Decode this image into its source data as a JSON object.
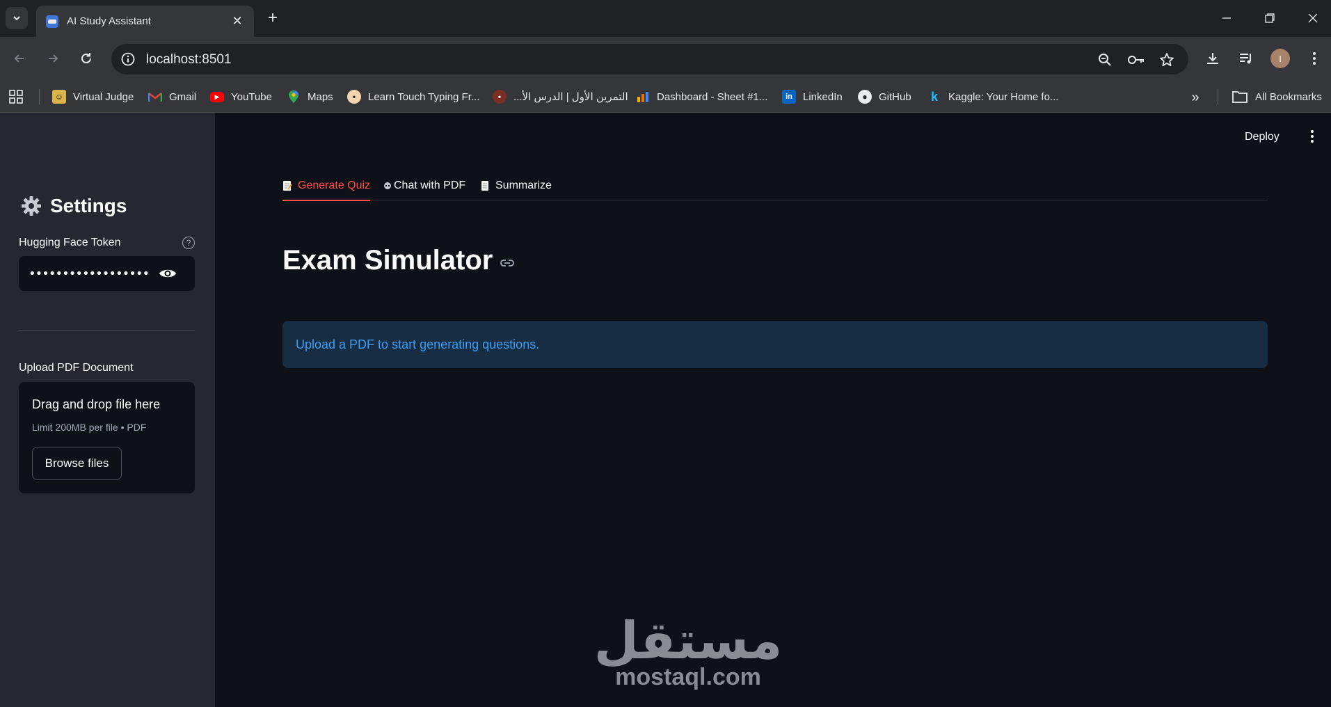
{
  "browser": {
    "tab_title": "AI Study Assistant",
    "url": "localhost:8501",
    "avatar_initial": "I",
    "bookmarks": [
      {
        "label": "Virtual Judge",
        "icon": "virtual-judge-icon"
      },
      {
        "label": "Gmail",
        "icon": "gmail-icon"
      },
      {
        "label": "YouTube",
        "icon": "youtube-icon"
      },
      {
        "label": "Maps",
        "icon": "maps-icon"
      },
      {
        "label": "Learn Touch Typing Fr...",
        "icon": "typing-icon"
      },
      {
        "label": "التمرين الأول | الدرس الأ...",
        "icon": "lesson-icon"
      },
      {
        "label": "Dashboard - Sheet #1...",
        "icon": "dashboard-icon"
      },
      {
        "label": "LinkedIn",
        "icon": "linkedin-icon"
      },
      {
        "label": "GitHub",
        "icon": "github-icon"
      },
      {
        "label": "Kaggle: Your Home fo...",
        "icon": "kaggle-icon"
      }
    ],
    "all_bookmarks_label": "All Bookmarks"
  },
  "sidebar": {
    "title": "Settings",
    "token_label": "Hugging Face Token",
    "token_value": "••••••••••••••••••••••••••••",
    "upload_label": "Upload PDF Document",
    "dropzone_title": "Drag and drop file here",
    "dropzone_limit": "Limit 200MB per file • PDF",
    "browse_label": "Browse files"
  },
  "main": {
    "deploy_label": "Deploy",
    "tabs": [
      {
        "label": "Generate Quiz",
        "active": true
      },
      {
        "label": "Chat with PDF",
        "active": false
      },
      {
        "label": "Summarize",
        "active": false
      }
    ],
    "title": "Exam Simulator",
    "info_message": "Upload a PDF to start generating questions."
  },
  "watermark": {
    "arabic": "مستقل",
    "latin": "mostaql.com"
  },
  "colors": {
    "accent": "#ff4b4b",
    "info_text": "#3d9df3",
    "info_bg": "#172d43",
    "sidebar_bg": "#262730",
    "main_bg": "#0e1117"
  }
}
